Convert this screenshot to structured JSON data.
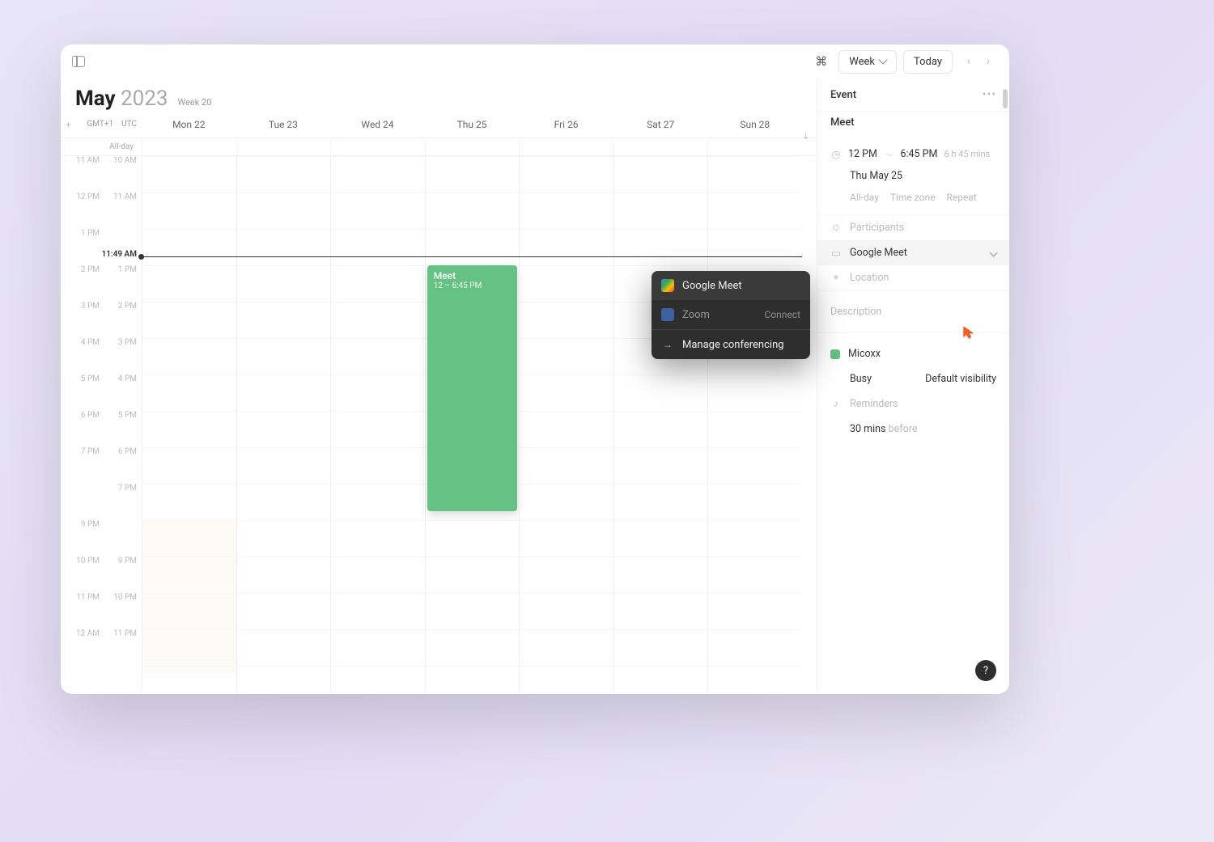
{
  "toolbar": {
    "view_label": "Week",
    "today_label": "Today"
  },
  "header": {
    "month": "May",
    "year": "2023",
    "week_label": "Week 20"
  },
  "timezones": {
    "left": "GMT+1",
    "right": "UTC"
  },
  "days": [
    "Mon 22",
    "Tue 23",
    "Wed 24",
    "Thu 25",
    "Fri 26",
    "Sat 27",
    "Sun 28"
  ],
  "allday_label": "All-day",
  "hours_left": [
    "11 AM",
    "12 PM",
    "1 PM",
    "2 PM",
    "3 PM",
    "4 PM",
    "5 PM",
    "6 PM",
    "7 PM",
    "",
    "9 PM",
    "10 PM",
    "11 PM",
    "12 AM"
  ],
  "hours_right": [
    "10 AM",
    "11 AM",
    "",
    "1 PM",
    "2 PM",
    "3 PM",
    "4 PM",
    "5 PM",
    "6 PM",
    "7 PM",
    "",
    "9 PM",
    "10 PM",
    "11 PM"
  ],
  "now_label": "11:49 AM",
  "event_block": {
    "title": "Meet",
    "time": "12 – 6:45 PM"
  },
  "popup": {
    "google_meet": "Google Meet",
    "zoom": "Zoom",
    "connect": "Connect",
    "manage": "Manage conferencing"
  },
  "side": {
    "header": "Event",
    "title": "Meet",
    "start": "12 PM",
    "end": "6:45 PM",
    "duration": "6 h 45 mins",
    "date": "Thu May 25",
    "opt_allday": "All-day",
    "opt_timezone": "Time zone",
    "opt_repeat": "Repeat",
    "participants": "Participants",
    "conferencing": "Google Meet",
    "location": "Location",
    "description": "Description",
    "calendar": "Micoxx",
    "availability": "Busy",
    "visibility": "Default visibility",
    "reminders": "Reminders",
    "reminder_value": "30 mins",
    "reminder_suffix": "before"
  },
  "help": "?"
}
